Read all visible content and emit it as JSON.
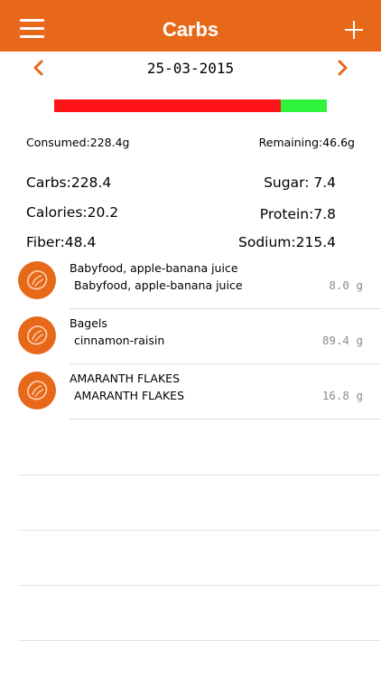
{
  "header": {
    "title": "Carbs",
    "menu_icon": "hamburger-menu-icon",
    "add_icon": "plus-icon"
  },
  "date_nav": {
    "date": "25-03-2015",
    "prev_icon": "chevron-left-icon",
    "next_icon": "chevron-right-icon"
  },
  "progress": {
    "consumed_fraction": 0.8305,
    "consumed_color": "#ff1419",
    "remaining_color": "#2ff23a"
  },
  "summary": {
    "consumed": "Consumed:228.4g",
    "remaining": "Remaining:46.6g"
  },
  "nutrients": {
    "carbs": "Carbs:228.4",
    "sugar": "Sugar:  7.4",
    "calories": "Calories:20.2",
    "protein": "Protein:7.8",
    "fiber": "Fiber:48.4",
    "sodium": "Sodium:215.4"
  },
  "foods": [
    {
      "name": "Babyfood, apple-banana juice",
      "desc": "Babyfood, apple-banana juice",
      "amount": "8.0 g"
    },
    {
      "name": "Bagels",
      "desc": "cinnamon-raisin",
      "amount": "89.4 g"
    },
    {
      "name": "AMARANTH FLAKES",
      "desc": "AMARANTH FLAKES",
      "amount": "16.8 g"
    }
  ],
  "colors": {
    "accent": "#e8681a",
    "amount_text": "#8a8a8a"
  }
}
